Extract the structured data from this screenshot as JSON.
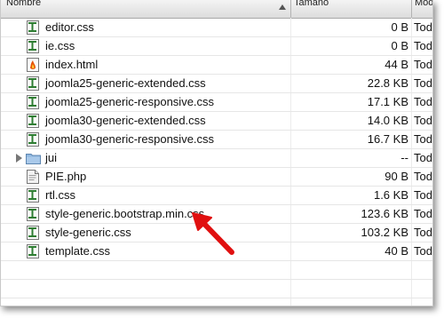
{
  "header": {
    "col_name": "Nombre",
    "col_size": "Tamaño",
    "col_kind": "Mod"
  },
  "rows": [
    {
      "name": "editor.css",
      "size": "0 B",
      "kind": "Tod",
      "icon": "css-file-icon"
    },
    {
      "name": "ie.css",
      "size": "0 B",
      "kind": "Tod",
      "icon": "css-file-icon"
    },
    {
      "name": "index.html",
      "size": "44 B",
      "kind": "Tod",
      "icon": "html-file-icon"
    },
    {
      "name": "joomla25-generic-extended.css",
      "size": "22.8 KB",
      "kind": "Tod",
      "icon": "css-file-icon"
    },
    {
      "name": "joomla25-generic-responsive.css",
      "size": "17.1 KB",
      "kind": "Tod",
      "icon": "css-file-icon"
    },
    {
      "name": "joomla30-generic-extended.css",
      "size": "14.0 KB",
      "kind": "Tod",
      "icon": "css-file-icon"
    },
    {
      "name": "joomla30-generic-responsive.css",
      "size": "16.7 KB",
      "kind": "Tod",
      "icon": "css-file-icon"
    },
    {
      "name": "jui",
      "size": "--",
      "kind": "Tod",
      "icon": "folder-icon"
    },
    {
      "name": "PIE.php",
      "size": "90 B",
      "kind": "Tod",
      "icon": "php-file-icon"
    },
    {
      "name": "rtl.css",
      "size": "1.6 KB",
      "kind": "Tod",
      "icon": "css-file-icon"
    },
    {
      "name": "style-generic.bootstrap.min.css",
      "size": "123.6 KB",
      "kind": "Tod",
      "icon": "css-file-icon"
    },
    {
      "name": "style-generic.css",
      "size": "103.2 KB",
      "kind": "Tod",
      "icon": "css-file-icon"
    },
    {
      "name": "template.css",
      "size": "40 B",
      "kind": "Tod",
      "icon": "css-file-icon"
    }
  ],
  "colors": {
    "annotation_arrow": "#e01010",
    "css_icon_accent": "#2e7d32",
    "html_icon_accent": "#e65100",
    "folder": "#8fb7df"
  }
}
